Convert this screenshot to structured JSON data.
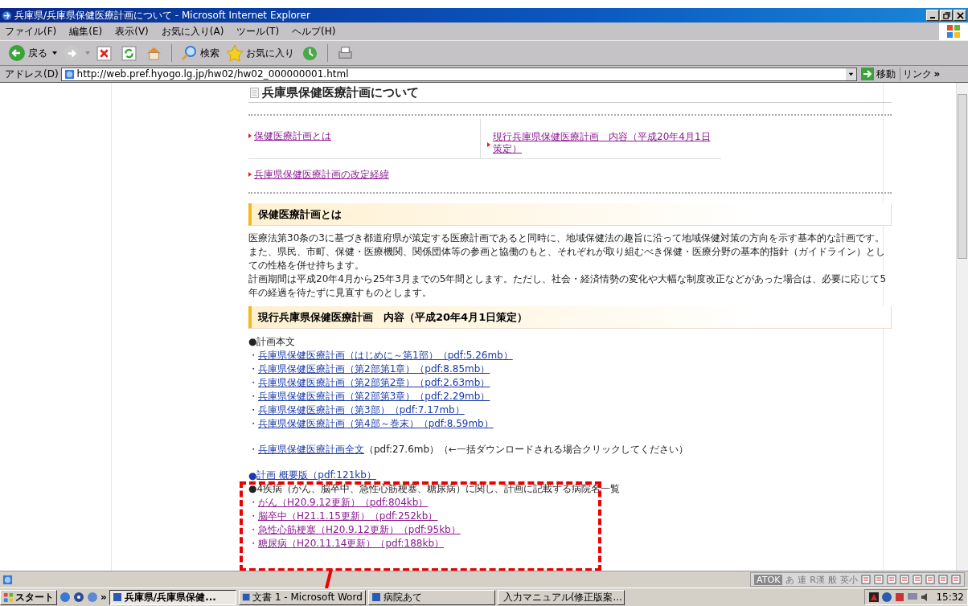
{
  "window": {
    "title": "兵庫県/兵庫県保健医療計画について - Microsoft Internet Explorer"
  },
  "menu": [
    "ファイル(F)",
    "編集(E)",
    "表示(V)",
    "お気に入り(A)",
    "ツール(T)",
    "ヘルプ(H)"
  ],
  "toolbar": {
    "back": "戻る",
    "search": "検索",
    "favorites": "お気に入り"
  },
  "address": {
    "label": "アドレス(D)",
    "value": "http://web.pref.hyogo.lg.jp/hw02/hw02_000000001.html",
    "go": "移動",
    "links": "リンク",
    "more": "»"
  },
  "page": {
    "title": "兵庫県保健医療計画について",
    "nav": [
      {
        "text": "保健医療計画とは",
        "visited": true
      },
      {
        "text": "現行兵庫県保健医療計画　内容（平成20年4月1日策定）",
        "visited": true
      },
      {
        "text": "兵庫県保健医療計画の改定経緯",
        "visited": true
      }
    ],
    "sections": [
      {
        "heading": "保健医療計画とは",
        "paragraphs": [
          "医療法第30条の3に基づき都道府県が策定する医療計画であると同時に、地域保健法の趣旨に沿って地域保健対策の方向を示す基本的な計画です。",
          "また、県民、市町、保健・医療機関、関係団体等の参画と協働のもと、それぞれが取り組むべき保健・医療分野の基本的指針（ガイドライン）としての性格を併せ持ちます。",
          "計画期間は平成20年4月から25年3月までの5年間とします。ただし、社会・経済情勢の変化や大幅な制度改正などがあった場合は、必要に応じて5年の経過を待たずに見直すものとします。"
        ]
      },
      {
        "heading": "現行兵庫県保健医療計画　内容（平成20年4月1日策定）"
      }
    ],
    "documents": [
      {
        "kind": "label",
        "bullet": "●",
        "text": "計画本文"
      },
      {
        "kind": "link",
        "bullet": "・",
        "link": "兵庫県保健医療計画（はじめに～第1部）（pdf:5.26mb）",
        "visited": false
      },
      {
        "kind": "link",
        "bullet": "・",
        "link": "兵庫県保健医療計画（第2部第1章）（pdf:8.85mb）",
        "visited": false
      },
      {
        "kind": "link",
        "bullet": "・",
        "link": "兵庫県保健医療計画（第2部第2章）（pdf:2.63mb）",
        "visited": false
      },
      {
        "kind": "link",
        "bullet": "・",
        "link": "兵庫県保健医療計画（第2部第3章）（pdf:2.29mb）",
        "visited": false
      },
      {
        "kind": "link",
        "bullet": "・",
        "link": "兵庫県保健医療計画（第3部）（pdf:7.17mb）",
        "visited": false
      },
      {
        "kind": "link",
        "bullet": "・",
        "link": "兵庫県保健医療計画（第4部～巻末）（pdf:8.59mb）",
        "visited": false
      },
      {
        "kind": "gap"
      },
      {
        "kind": "link",
        "bullet": "・",
        "link": "兵庫県保健医療計画全文",
        "note": "（pdf:27.6mb）（←一括ダウンロードされる場合クリックしてください）",
        "visited": false
      },
      {
        "kind": "gap"
      },
      {
        "kind": "link",
        "bullet": "●",
        "link": "計画 概要版（pdf:121kb）",
        "visited": false
      },
      {
        "kind": "label",
        "bullet": "●",
        "text": "4疾病（がん、脳卒中、急性心筋梗塞、糖尿病）に関し、計画に記載する病院名一覧"
      },
      {
        "kind": "link",
        "bullet": "・",
        "link": "がん（H20.9.12更新）（pdf:804kb）",
        "visited": true
      },
      {
        "kind": "link",
        "bullet": "・",
        "link": "脳卒中（H21.1.15更新）（pdf:252kb）",
        "visited": true
      },
      {
        "kind": "link",
        "bullet": "・",
        "link": "急性心筋梗塞（H20.9.12更新）（pdf:95kb）",
        "visited": true
      },
      {
        "kind": "link",
        "bullet": "・",
        "link": "糖尿病（H20.11.14更新）（pdf:188kb）",
        "visited": true
      }
    ]
  },
  "language_bar": [
    "ATOK",
    "あ",
    "連",
    "R漢",
    "般",
    "英小"
  ],
  "taskbar": {
    "start": "スタート",
    "more": "»",
    "tasks": [
      {
        "label": "兵庫県/兵庫県保健...",
        "selected": true
      },
      {
        "label": "文書 1 - Microsoft Word",
        "selected": false
      },
      {
        "label": "病院あて",
        "selected": false
      },
      {
        "label": "入力マニュアル(修正版案...",
        "selected": false
      }
    ],
    "clock": "15:32"
  }
}
